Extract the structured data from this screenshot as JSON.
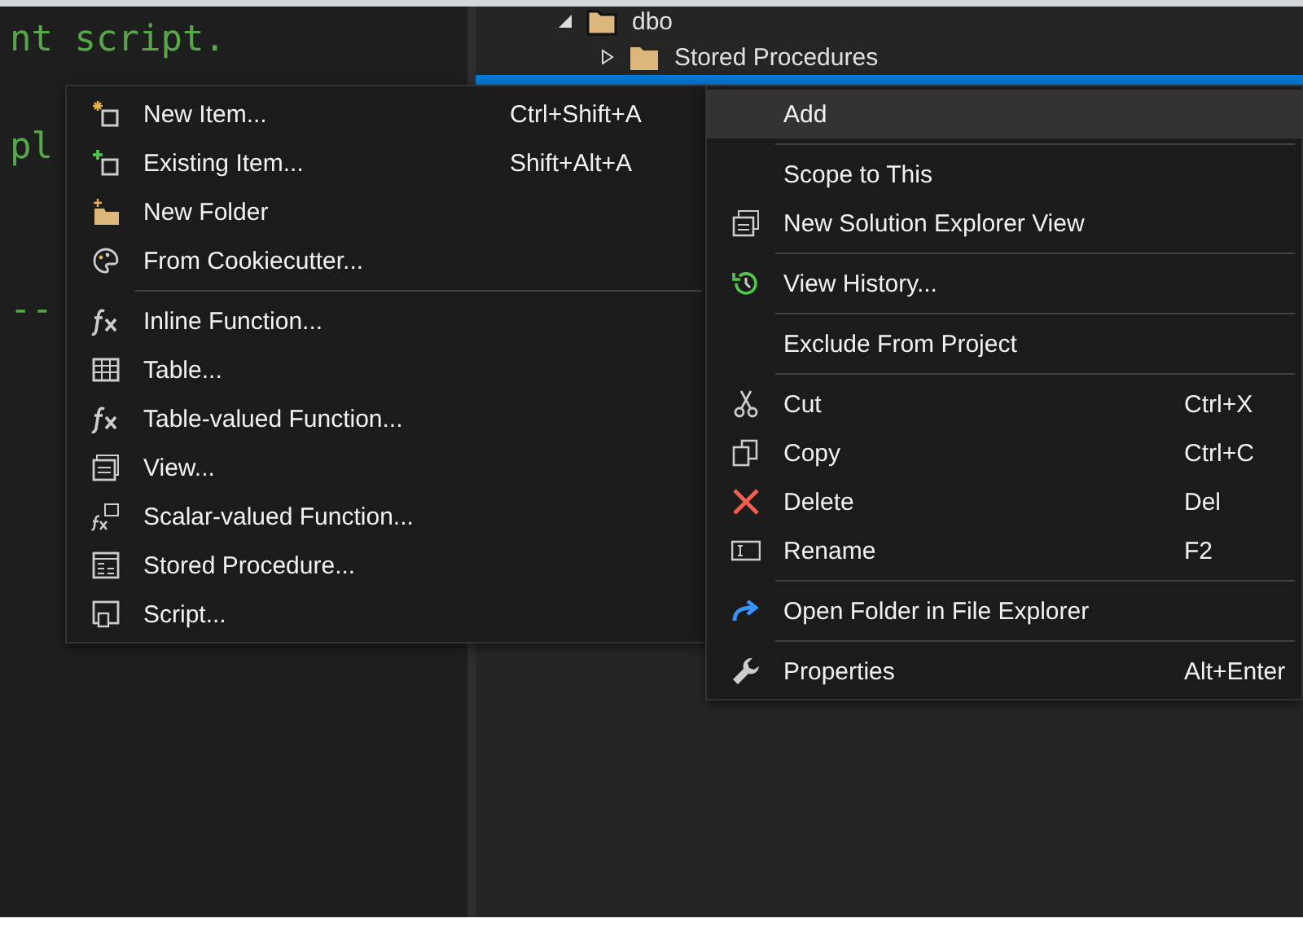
{
  "editor": {
    "lines": [
      "nt script.",
      "pl",
      "--"
    ]
  },
  "solution_explorer": {
    "tree": [
      {
        "label": "dbo",
        "expanded": true,
        "selected": false,
        "children": [
          {
            "label": "Stored Procedures",
            "expanded": false,
            "selected": false
          },
          {
            "selected": true
          }
        ]
      }
    ]
  },
  "add_submenu": {
    "items": [
      {
        "kind": "item",
        "label": "New Item...",
        "shortcut": "Ctrl+Shift+A"
      },
      {
        "kind": "item",
        "label": "Existing Item...",
        "shortcut": "Shift+Alt+A"
      },
      {
        "kind": "item",
        "label": "New Folder"
      },
      {
        "kind": "item",
        "label": "From Cookiecutter..."
      },
      {
        "kind": "separator"
      },
      {
        "kind": "item",
        "label": "Inline Function..."
      },
      {
        "kind": "item",
        "label": "Table..."
      },
      {
        "kind": "item",
        "label": "Table-valued Function..."
      },
      {
        "kind": "item",
        "label": "View..."
      },
      {
        "kind": "item",
        "label": "Scalar-valued Function..."
      },
      {
        "kind": "item",
        "label": "Stored Procedure..."
      },
      {
        "kind": "item",
        "label": "Script..."
      }
    ]
  },
  "context_menu": {
    "items": [
      {
        "kind": "item",
        "label": "Add",
        "selected": true
      },
      {
        "kind": "separator"
      },
      {
        "kind": "item",
        "label": "Scope to This",
        "selected": false
      },
      {
        "kind": "item",
        "label": "New Solution Explorer View",
        "selected": false
      },
      {
        "kind": "separator"
      },
      {
        "kind": "item",
        "label": "View History...",
        "selected": false
      },
      {
        "kind": "separator"
      },
      {
        "kind": "item",
        "label": "Exclude From Project",
        "selected": false
      },
      {
        "kind": "separator"
      },
      {
        "kind": "item",
        "label": "Cut",
        "shortcut": "Ctrl+X",
        "selected": false
      },
      {
        "kind": "item",
        "label": "Copy",
        "shortcut": "Ctrl+C",
        "selected": false
      },
      {
        "kind": "item",
        "label": "Delete",
        "shortcut": "Del",
        "selected": false
      },
      {
        "kind": "item",
        "label": "Rename",
        "shortcut": "F2",
        "selected": false
      },
      {
        "kind": "separator"
      },
      {
        "kind": "item",
        "label": "Open Folder in File Explorer",
        "selected": false
      },
      {
        "kind": "separator"
      },
      {
        "kind": "item",
        "label": "Properties",
        "shortcut": "Alt+Enter",
        "selected": false
      }
    ]
  }
}
